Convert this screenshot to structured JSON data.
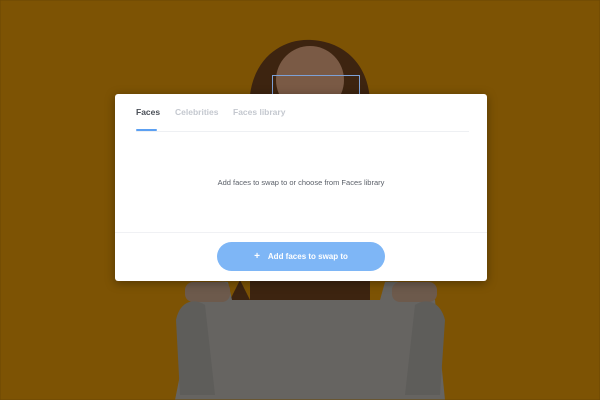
{
  "colors": {
    "overlay_background": "#7d5304",
    "modal_background": "#ffffff",
    "active_tab_text": "#4a4f57",
    "inactive_tab_text": "#c4c8cf",
    "tab_indicator": "#5ca0f2",
    "primary_button": "#7eb6f6"
  },
  "tabs": [
    {
      "label": "Faces",
      "active": true
    },
    {
      "label": "Celebrities",
      "active": false
    },
    {
      "label": "Faces library",
      "active": false
    }
  ],
  "main": {
    "empty_message": "Add faces to swap to or choose from Faces library"
  },
  "footer": {
    "button_icon": "plus-icon",
    "button_label": "Add faces to swap to"
  }
}
